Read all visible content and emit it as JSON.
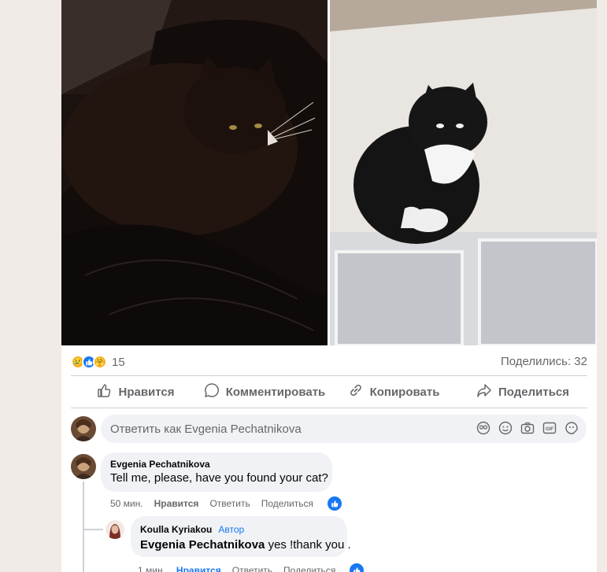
{
  "post": {
    "reactions": {
      "count": "15",
      "icons": [
        "sad-reaction-icon",
        "like-reaction-icon",
        "care-reaction-icon"
      ]
    },
    "shares_label": "Поделились: 32",
    "actions": {
      "like": "Нравится",
      "comment": "Комментировать",
      "copy": "Копировать",
      "share": "Поделиться"
    }
  },
  "composer": {
    "placeholder": "Ответить как Evgenia Pechatnikova"
  },
  "comments": [
    {
      "author": "Evgenia Pechatnikova",
      "text": "Tell me, please, have you found your cat?",
      "time": "50 мин.",
      "like": "Нравится",
      "reply": "Ответить",
      "share": "Поделиться"
    },
    {
      "author": "Koulla Kyriakou",
      "tag": "Автор",
      "mention": "Evgenia Pechatnikova",
      "text": " yes !thank you .",
      "time": "1 мин.",
      "like": "Нравится",
      "reply": "Ответить",
      "share": "Поделиться"
    }
  ],
  "colors": {
    "accent": "#1877f2",
    "muted": "#65676b",
    "bubble": "#f0f2f5"
  }
}
